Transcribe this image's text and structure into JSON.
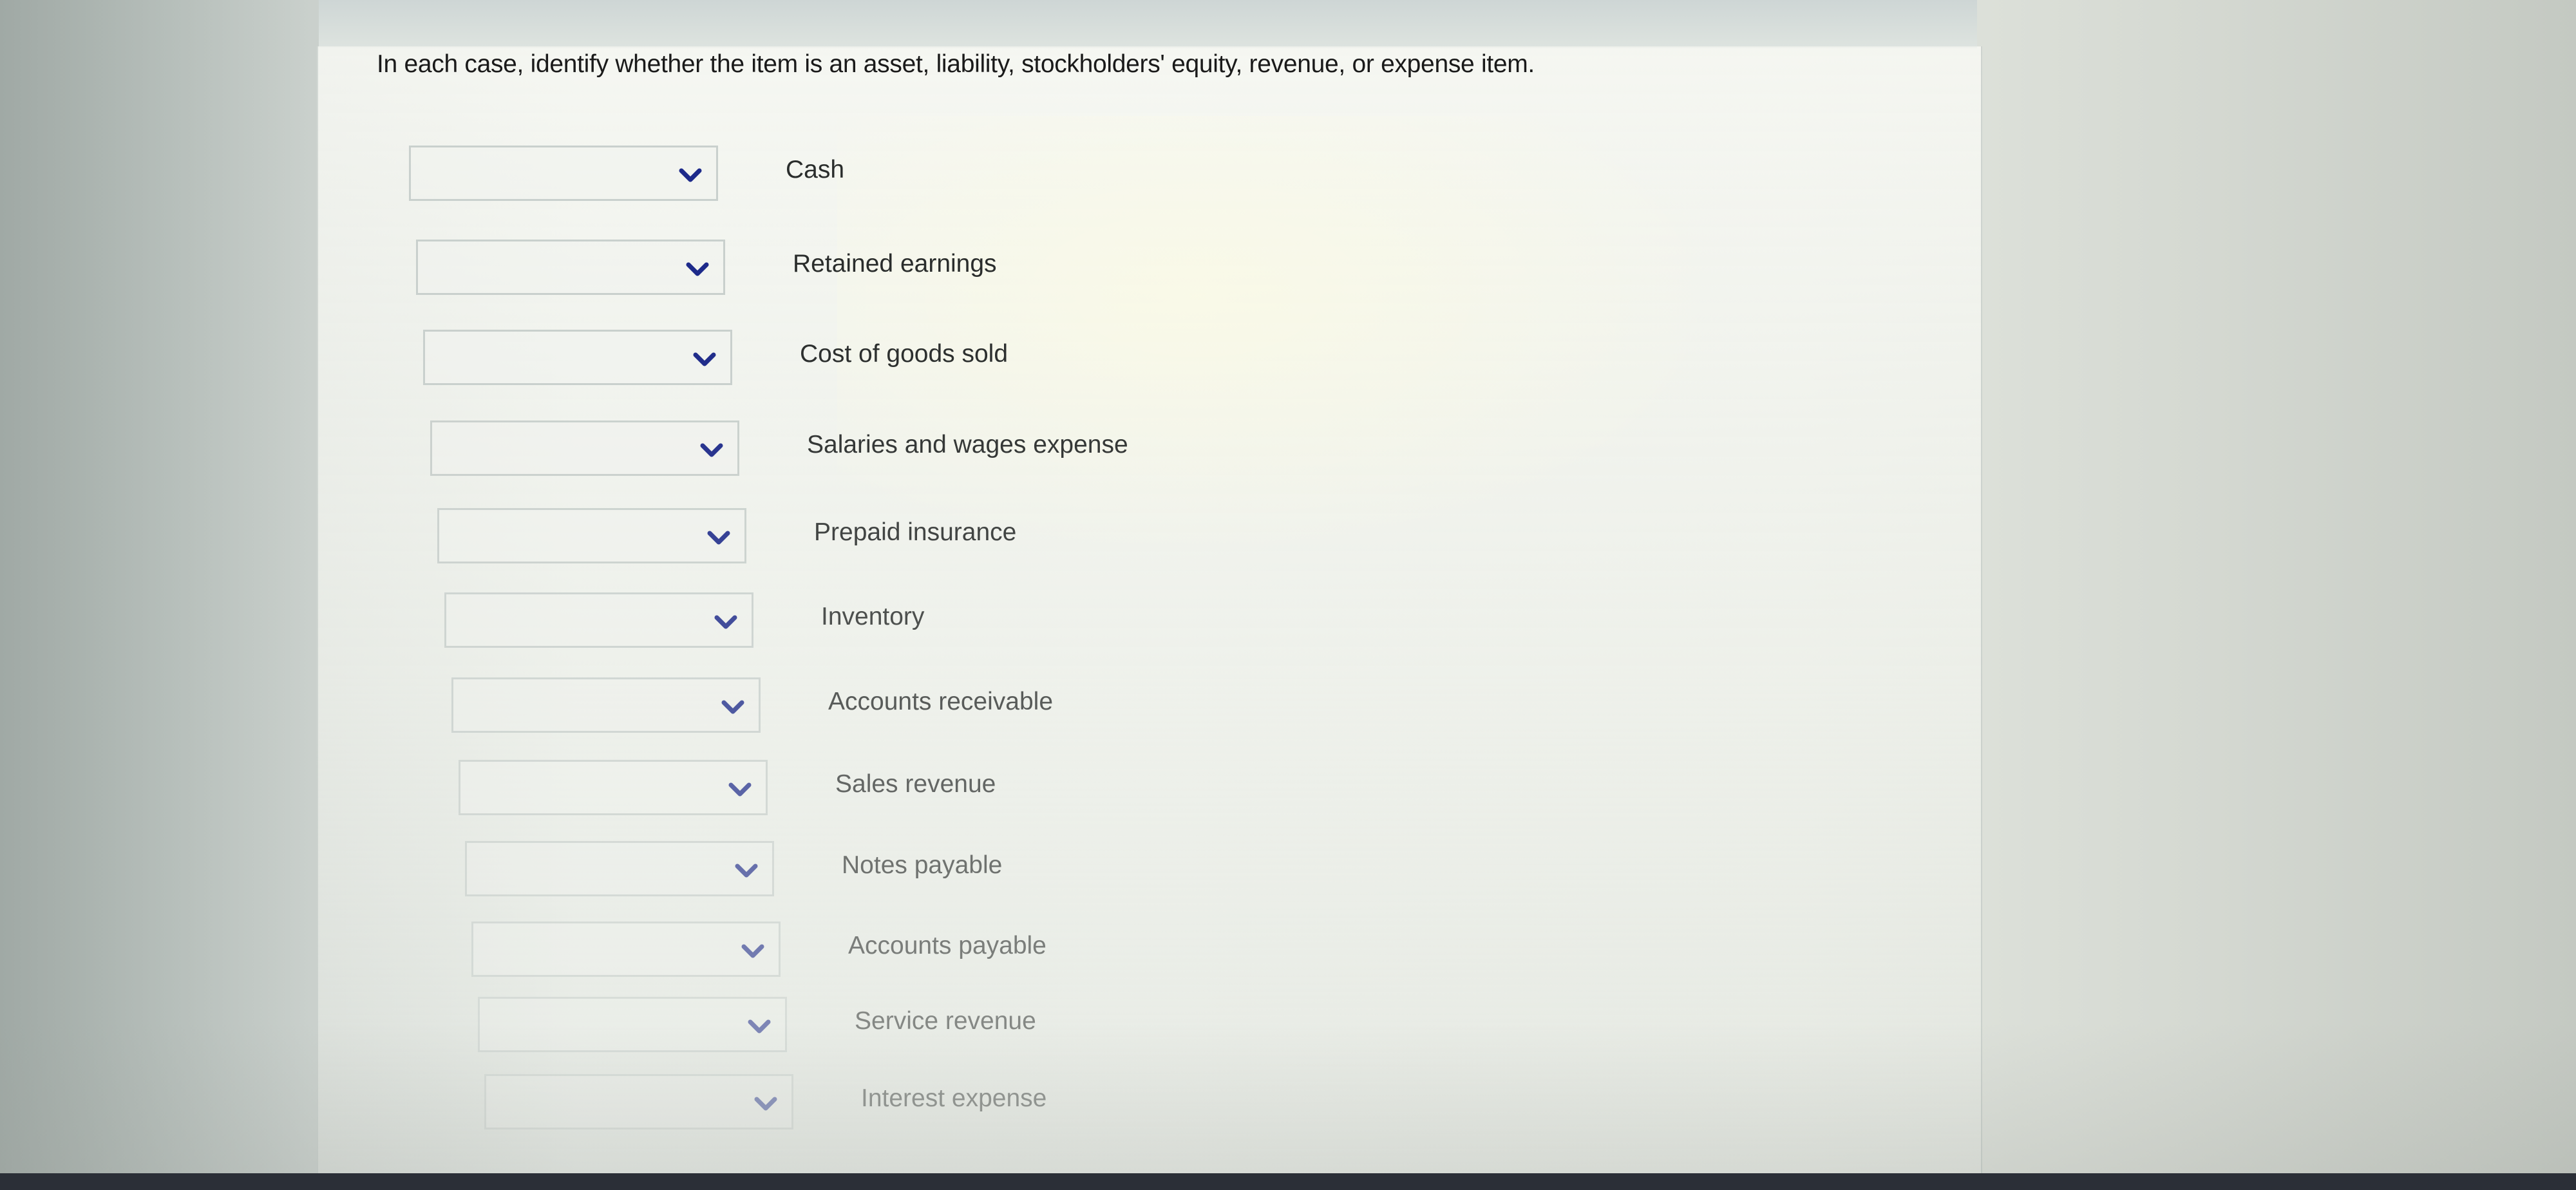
{
  "question": {
    "instructions": "In each case, identify whether the item is an asset, liability, stockholders' equity, revenue, or expense item."
  },
  "items": [
    {
      "label": "Cash",
      "selected": ""
    },
    {
      "label": "Retained earnings",
      "selected": ""
    },
    {
      "label": "Cost of goods sold",
      "selected": ""
    },
    {
      "label": "Salaries and wages expense",
      "selected": ""
    },
    {
      "label": "Prepaid insurance",
      "selected": ""
    },
    {
      "label": "Inventory",
      "selected": ""
    },
    {
      "label": "Accounts receivable",
      "selected": ""
    },
    {
      "label": "Sales revenue",
      "selected": ""
    },
    {
      "label": "Notes payable",
      "selected": ""
    },
    {
      "label": "Accounts payable",
      "selected": ""
    },
    {
      "label": "Service revenue",
      "selected": ""
    },
    {
      "label": "Interest expense",
      "selected": ""
    }
  ],
  "icons": {
    "dropdown": "chevron-down-icon"
  },
  "colors": {
    "label_text": "#2a2d2c",
    "chevron": "#1d2a8a",
    "select_border": "#c9d0cd"
  }
}
